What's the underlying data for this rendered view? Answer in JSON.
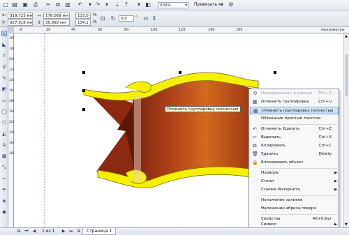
{
  "toolbar1": {
    "zoom_value": "200%",
    "snap_label": "Привязать к"
  },
  "toolbar2": {
    "x_label": "x:",
    "x_value": "319,723 мм",
    "y_label": "y:",
    "y_value": "927,918 мм",
    "w_value": "178,069 мм",
    "h_value": "30,892 мм",
    "scale_x": "133,0",
    "scale_y": "134,1",
    "pct": "%",
    "rotation": "0,0",
    "deg": "°"
  },
  "ruler": {
    "ticks": [
      "0",
      "20",
      "40",
      "60",
      "80",
      "100",
      "120",
      "140",
      "160"
    ],
    "ruler_ticks": [
      "160",
      "180",
      "200",
      "220",
      "240",
      "260",
      "280",
      "300",
      "320",
      "340",
      "360",
      "380"
    ],
    "units": "миллиметры"
  },
  "tooltip": "Отменить группировку полностью",
  "context_menu": [
    {
      "icon": "convert-icon",
      "glyph": "⟲",
      "label": "Преобразовать в кривую",
      "shortcut": "Ctrl+Q",
      "disabled": true
    },
    {
      "icon": "ungroup-icon",
      "glyph": "▦",
      "label": "Отменить группировку",
      "shortcut": "Ctrl+U",
      "disabled": false
    },
    {
      "icon": "ungroup-all-icon",
      "glyph": "▦",
      "label": "Отменить группировку полностью",
      "shortcut": "",
      "disabled": false,
      "highlighted": true
    },
    {
      "icon": "",
      "glyph": "",
      "label": "Обтекание простым текстом",
      "shortcut": "",
      "disabled": false
    },
    {
      "icon": "undo-icon",
      "glyph": "↶",
      "label": "Отменить Удалить",
      "shortcut": "Ctrl+Z",
      "disabled": false
    },
    {
      "icon": "cut-icon",
      "glyph": "✂",
      "label": "Вырезать",
      "shortcut": "Ctrl+X",
      "disabled": false
    },
    {
      "icon": "copy-icon",
      "glyph": "⧉",
      "label": "Копировать",
      "shortcut": "Ctrl+C",
      "disabled": false
    },
    {
      "icon": "delete-icon",
      "glyph": "🗑",
      "label": "Удалить",
      "shortcut": "Delete",
      "disabled": false
    },
    {
      "icon": "lock-icon",
      "glyph": "🔒",
      "label": "Блокировать объект",
      "shortcut": "",
      "disabled": false
    },
    {
      "icon": "",
      "glyph": "",
      "label": "Порядок",
      "shortcut": "",
      "submenu": true
    },
    {
      "icon": "",
      "glyph": "",
      "label": "Стили",
      "shortcut": "",
      "submenu": true
    },
    {
      "icon": "",
      "glyph": "",
      "label": "Ссылки Интернета",
      "shortcut": "",
      "submenu": true
    },
    {
      "icon": "",
      "glyph": "",
      "label": "Наложение заливки",
      "shortcut": ""
    },
    {
      "icon": "",
      "glyph": "",
      "label": "Наложение абриса поверх",
      "shortcut": ""
    },
    {
      "icon": "",
      "glyph": "",
      "label": "Свойства",
      "shortcut": "Alt+Enter"
    },
    {
      "icon": "",
      "glyph": "",
      "label": "Символ",
      "shortcut": "",
      "submenu": true
    }
  ],
  "status": {
    "page_of": "1 из 1",
    "page_tab": "Страница 1"
  },
  "colors": {
    "ribbon_yellow": "#f5f000",
    "ribbon_brown": "#8e2f10",
    "ribbon_orange": "#cf5d18",
    "highlight": "#c3daf7"
  }
}
